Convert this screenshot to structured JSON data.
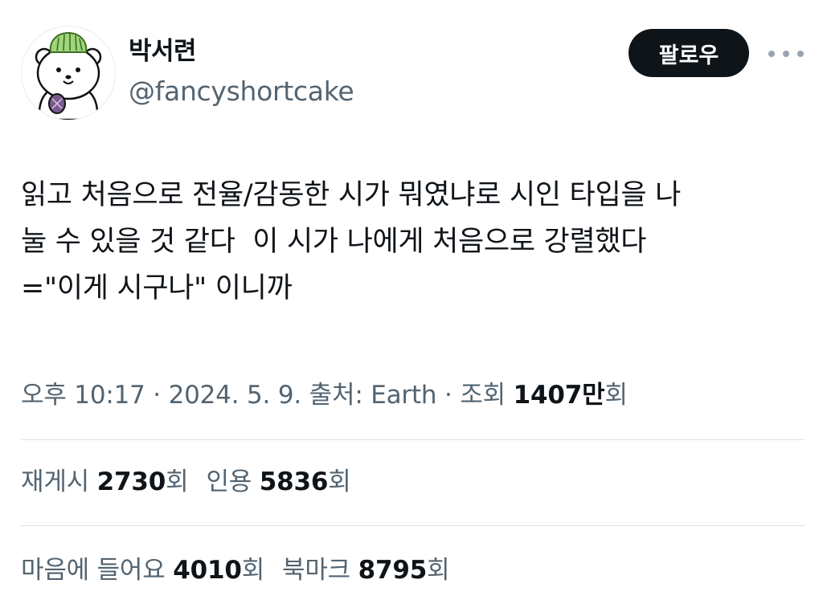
{
  "author": {
    "display_name": "박서련",
    "handle": "@fancyshortcake",
    "avatar": "white-bear-with-green-cabbage-hat"
  },
  "follow_label": "팔로우",
  "more_icon": "more-horizontal-icon",
  "tweet": {
    "lines": [
      "읽고 처음으로 전율/감동한 시가 뭐였냐로 시인 타입을 나",
      "눌 수 있을 것 같다  이 시가 나에게 처음으로 강렬했다",
      "=\"이게 시구나\" 이니까"
    ]
  },
  "meta": {
    "time": "오후 10:17",
    "sep1": " · ",
    "date": "2024. 5. 9.",
    "source": " 출처: Earth",
    "sep2": " · ",
    "views_label": "조회 ",
    "views_value": "1407만",
    "views_suffix": "회"
  },
  "stats": {
    "retweets_label": "재게시 ",
    "retweets_value": "2730",
    "retweets_suffix": "회",
    "quotes_label": "인용 ",
    "quotes_value": "5836",
    "quotes_suffix": "회",
    "likes_label": "마음에 들어요 ",
    "likes_value": "4010",
    "likes_suffix": "회",
    "bookmarks_label": "북마크 ",
    "bookmarks_value": "8795",
    "bookmarks_suffix": "회"
  },
  "colors": {
    "text": "#0f1419",
    "secondary": "#536471",
    "button_bg": "#0f1419",
    "divider": "#dfe3e6"
  }
}
